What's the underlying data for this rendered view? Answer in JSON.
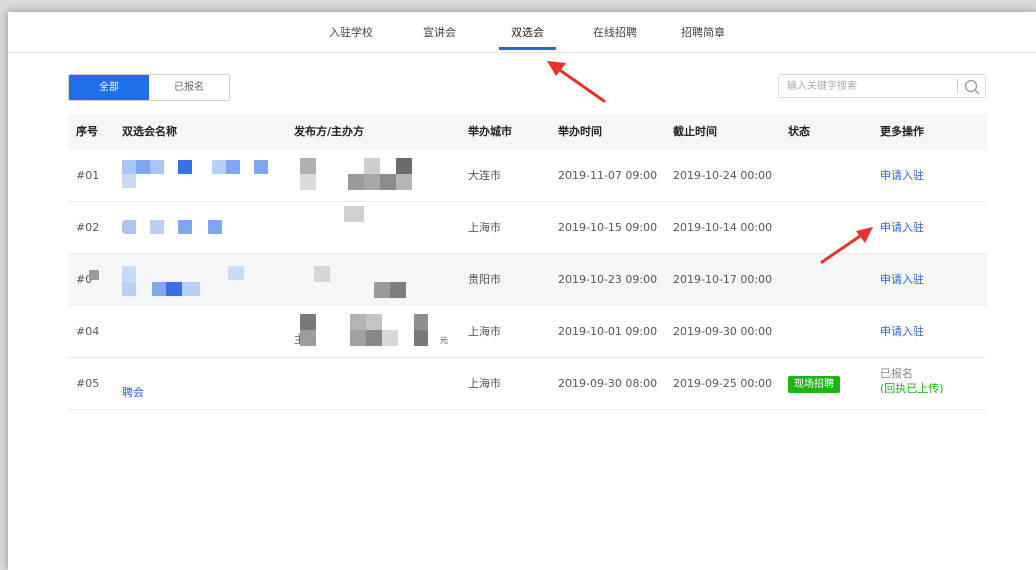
{
  "nav": {
    "items": [
      {
        "label": "入驻学校"
      },
      {
        "label": "宣讲会"
      },
      {
        "label": "双选会"
      },
      {
        "label": "在线招聘"
      },
      {
        "label": "招聘简章"
      }
    ],
    "active": "双选会"
  },
  "filters": {
    "all": "全部",
    "registered": "已报名",
    "active": "全部"
  },
  "search": {
    "placeholder": "输入关键字搜索",
    "value": ""
  },
  "table": {
    "headers": [
      "序号",
      "双选会名称",
      "发布方/主办方",
      "举办城市",
      "举办时间",
      "截止时间",
      "状态",
      "更多操作"
    ],
    "rows": [
      {
        "id": "#01",
        "name": "",
        "organizer": "",
        "city": "大连市",
        "start": "2019-11-07 09:00",
        "deadline": "2019-10-24 00:00",
        "status": "",
        "action": "申请入驻"
      },
      {
        "id": "#02",
        "name": "",
        "organizer": "",
        "city": "上海市",
        "start": "2019-10-15 09:00",
        "deadline": "2019-10-14 00:00",
        "status": "",
        "action": "申请入驻"
      },
      {
        "id": "#0",
        "name": "",
        "organizer": "",
        "city": "贵阳市",
        "start": "2019-10-23 09:00",
        "deadline": "2019-10-17 00:00",
        "status": "",
        "action": "申请入驻"
      },
      {
        "id": "#04",
        "name": "",
        "organizer": "主办",
        "organizer_tail": "元",
        "city": "上海市",
        "start": "2019-10-01 09:00",
        "deadline": "2019-09-30 00:00",
        "status": "",
        "action": "申请入驻"
      },
      {
        "id": "#05",
        "name": "聘会",
        "organizer": "",
        "city": "上海市",
        "start": "2019-09-30 08:00",
        "deadline": "2019-09-25 00:00",
        "status": "现场招聘",
        "action": "已报名",
        "action_note": "(回执已上传)"
      }
    ]
  },
  "colors": {
    "accent": "#2e62d9",
    "filter_active": "#1f6fe8",
    "badge": "#1fb318",
    "annotation_arrow": "#e8312a"
  },
  "icons": {
    "search": "search-icon",
    "arrow": "annotation-arrow-icon"
  }
}
